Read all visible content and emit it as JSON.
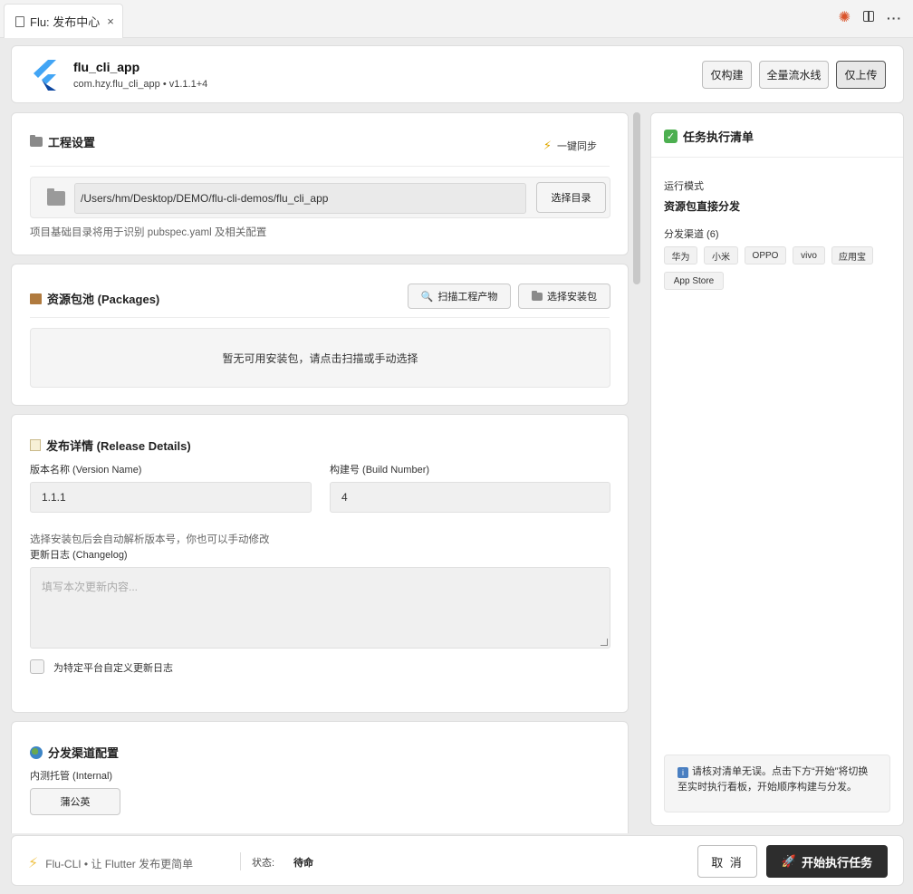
{
  "tab": {
    "title": "Flu: 发布中心",
    "close": "×"
  },
  "header": {
    "app_name": "flu_cli_app",
    "app_sub": "com.hzy.flu_cli_app • v1.1.1+4",
    "buttons": {
      "build_only": "仅构建",
      "full_pipeline": "全量流水线",
      "upload_only": "仅上传"
    }
  },
  "project": {
    "title": "工程设置",
    "sync": "一键同步",
    "path": "/Users/hm/Desktop/DEMO/flu-cli-demos/flu_cli_app",
    "choose_dir": "选择目录",
    "hint": "项目基础目录将用于识别 pubspec.yaml 及相关配置"
  },
  "packages": {
    "title": "资源包池 (Packages)",
    "scan": "扫描工程产物",
    "choose": "选择安装包",
    "empty": "暂无可用安装包，请点击扫描或手动选择"
  },
  "release": {
    "title": "发布详情 (Release Details)",
    "version_label": "版本名称 (Version Name)",
    "version_value": "1.1.1",
    "build_label": "构建号 (Build Number)",
    "build_value": "4",
    "hint": "选择安装包后会自动解析版本号，你也可以手动修改",
    "changelog_label": "更新日志 (Changelog)",
    "changelog_placeholder": "填写本次更新内容...",
    "custom_label": "为特定平台自定义更新日志"
  },
  "distribution": {
    "title": "分发渠道配置",
    "internal_label": "内测托管 (Internal)",
    "pgyer": "蒲公英"
  },
  "checklist": {
    "title": "任务执行清单",
    "mode_label": "运行模式",
    "mode_value": "资源包直接分发",
    "channels_label": "分发渠道 (6)",
    "channels": [
      "华为",
      "小米",
      "OPPO",
      "vivo",
      "应用宝",
      "App Store"
    ],
    "notice": "请核对清单无误。点击下方“开始”将切换至实时执行看板，开始顺序构建与分发。"
  },
  "footer": {
    "brand": "Flu-CLI • 让 Flutter 发布更简单",
    "status_label": "状态:",
    "status_value": "待命",
    "cancel": "取 消",
    "start": "开始执行任务"
  },
  "colors": {
    "accent_dark": "#2d2d2d",
    "flutter_blue": "#42a5f5",
    "success": "#4caf50"
  }
}
